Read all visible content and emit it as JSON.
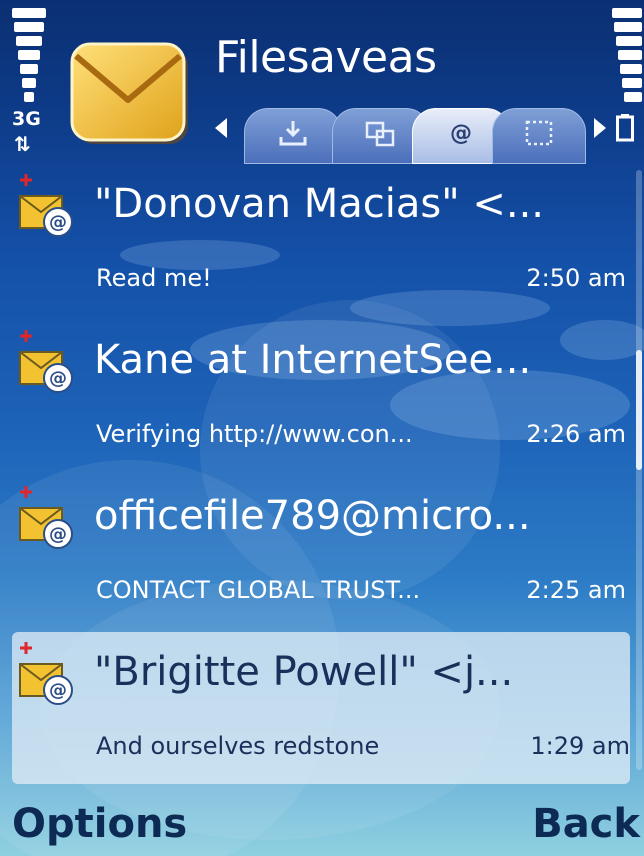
{
  "status": {
    "network": "3G"
  },
  "header": {
    "title": "Filesaveas",
    "tabs": [
      {
        "id": "inbox",
        "icon": "download-icon",
        "active": false
      },
      {
        "id": "folders",
        "icon": "folders-icon",
        "active": false
      },
      {
        "id": "email",
        "icon": "at-icon",
        "glyph": "@",
        "active": true
      },
      {
        "id": "drafts",
        "icon": "dotted-box-icon",
        "active": false
      }
    ]
  },
  "messages": [
    {
      "sender": "\"Donovan Macias\" <...",
      "preview": "Read me!",
      "time": "2:50 am",
      "unread": true,
      "selected": false
    },
    {
      "sender": "Kane at InternetSee...",
      "preview": "Verifying http://www.con...",
      "time": "2:26 am",
      "unread": true,
      "selected": false
    },
    {
      "sender": "officefile789@micro...",
      "preview": "CONTACT GLOBAL TRUST...",
      "time": "2:25 am",
      "unread": true,
      "selected": false
    },
    {
      "sender": "\"Brigitte Powell\" <j...",
      "preview": "And ourselves redstone",
      "time": "1:29 am",
      "unread": true,
      "selected": true
    }
  ],
  "softkeys": {
    "left": "Options",
    "right": "Back"
  },
  "colors": {
    "accent": "#0d2a55",
    "new_marker": "#e0262a",
    "envelope": "#f2c230"
  }
}
